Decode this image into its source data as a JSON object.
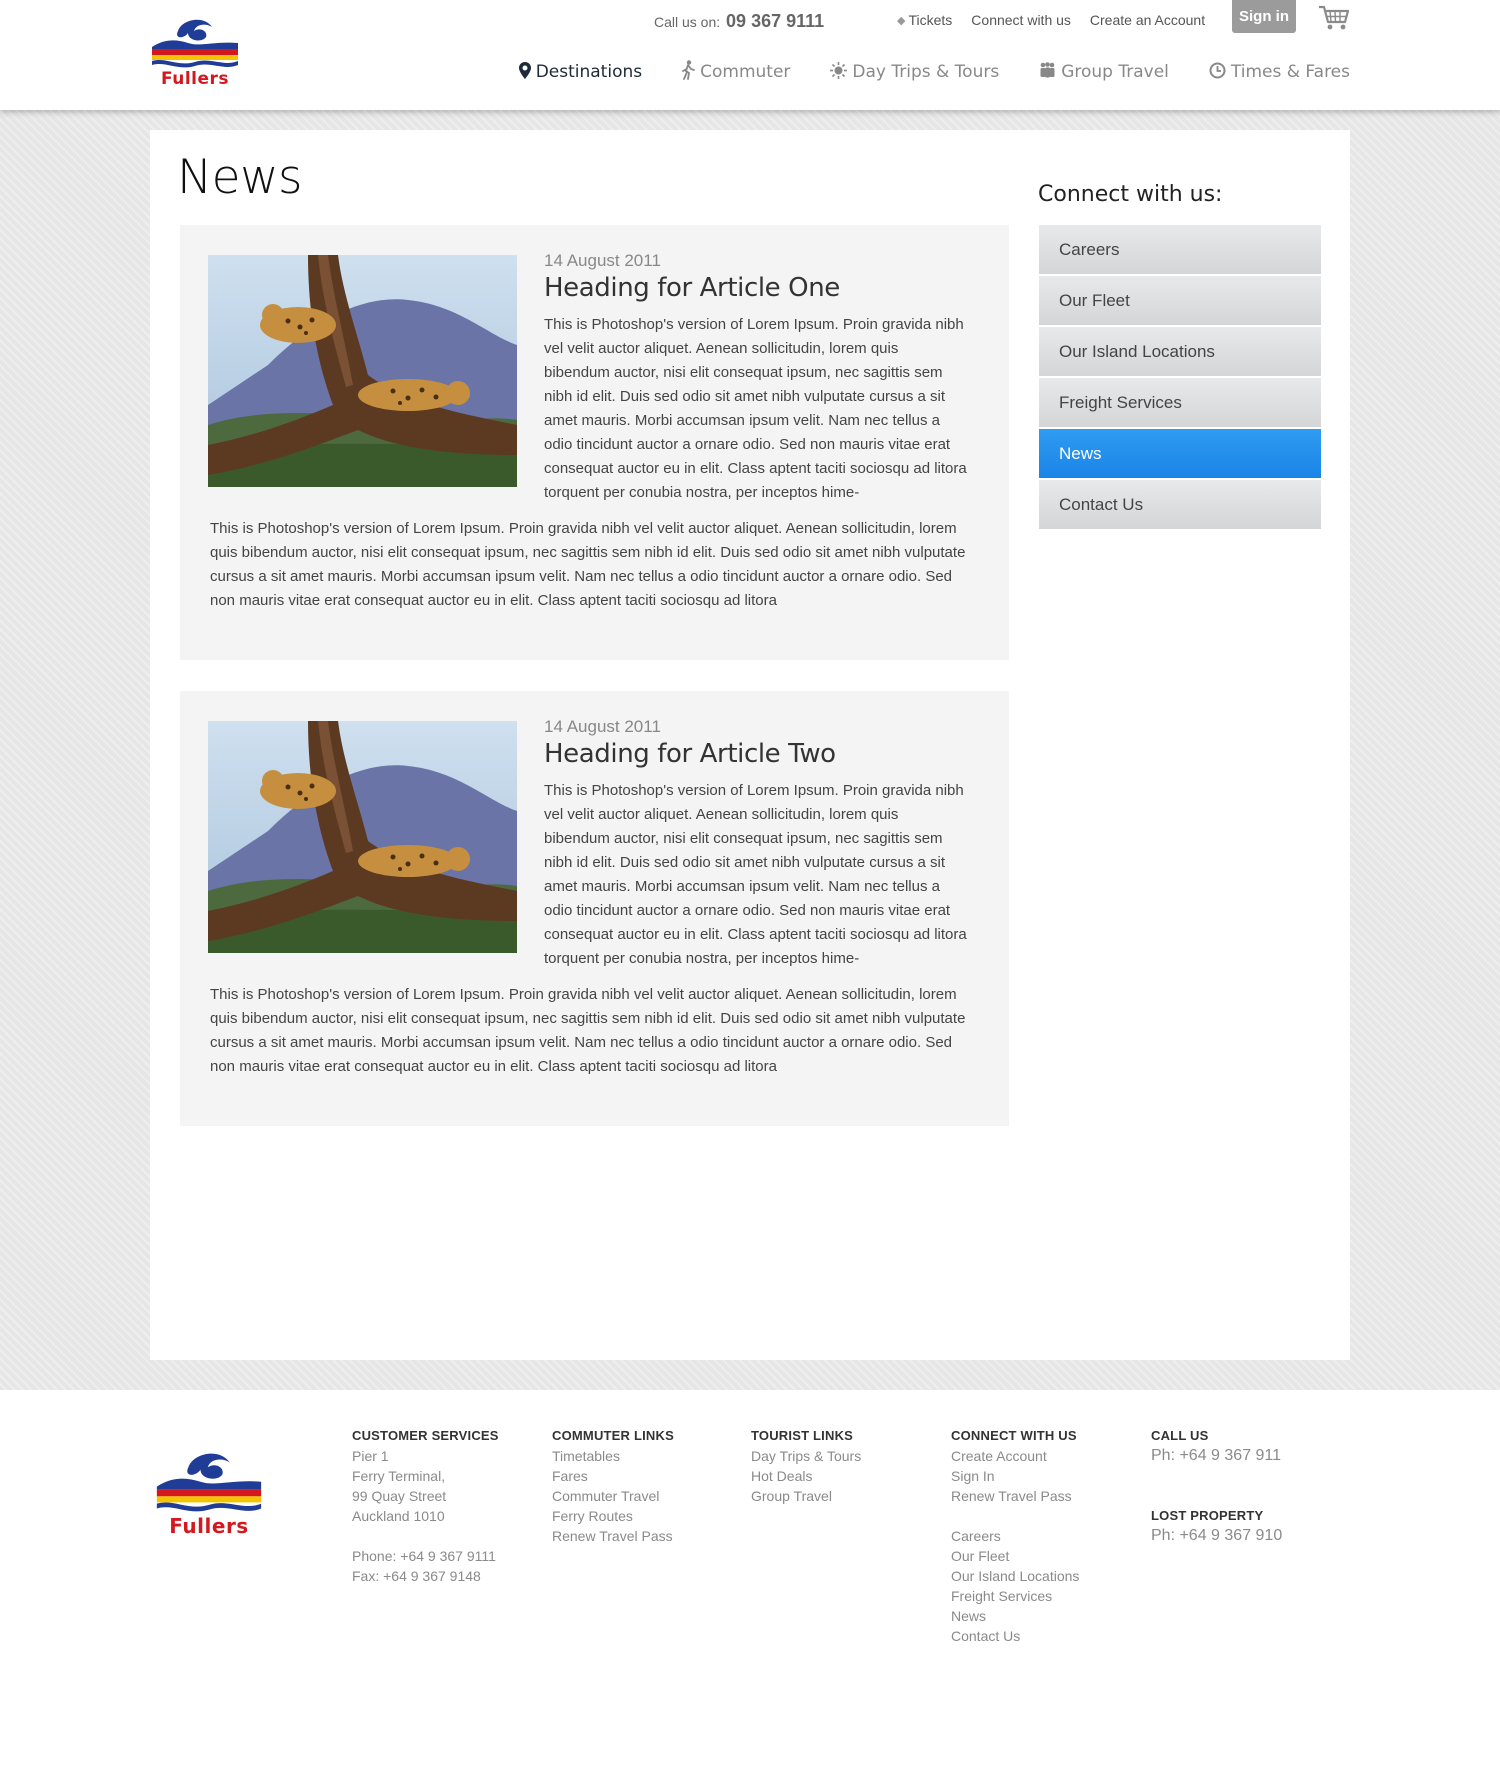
{
  "brand": {
    "name": "Fullers"
  },
  "header": {
    "callus_label": "Call us on:",
    "callus_number": "09 367 9111",
    "top_links": [
      {
        "label": "Tickets",
        "icon": "tag-icon"
      },
      {
        "label": "Connect with us"
      },
      {
        "label": "Create an Account"
      }
    ],
    "signin_label": "Sign in",
    "nav": [
      {
        "label": "Destinations",
        "icon": "map-pin-icon",
        "active": true
      },
      {
        "label": "Commuter",
        "icon": "walking-person-icon"
      },
      {
        "label": "Day Trips & Tours",
        "icon": "sun-icon"
      },
      {
        "label": "Group Travel",
        "icon": "group-icon"
      },
      {
        "label": "Times & Fares",
        "icon": "clock-icon"
      }
    ]
  },
  "page": {
    "title": "News"
  },
  "articles": [
    {
      "date": "14 August 2011",
      "heading": "Heading for Article One",
      "image": "leopard-in-tree",
      "para1": "This is Photoshop's version  of Lorem Ipsum. Proin gravida nibh vel velit auctor aliquet. Aenean sollicitudin, lorem quis bibendum auctor, nisi elit consequat ipsum, nec sagittis sem nibh id elit. Duis sed odio sit amet nibh vulputate cursus a sit amet mauris. Morbi accumsan ipsum velit. Nam nec tellus a odio tincidunt auctor a ornare odio. Sed non  mauris vitae erat consequat auctor eu in elit. Class aptent taciti sociosqu ad litora torquent per conubia nostra, per inceptos hime-",
      "para2": "This is Photoshop's version  of Lorem Ipsum. Proin gravida nibh vel velit auctor aliquet. Aenean sollicitudin, lorem quis bibendum auctor, nisi elit consequat ipsum, nec sagittis sem nibh id elit. Duis sed odio sit amet nibh vulputate cursus a sit amet mauris. Morbi accumsan ipsum velit. Nam nec tellus a odio tincidunt auctor a ornare odio. Sed non  mauris vitae erat consequat auctor eu in elit. Class aptent taciti sociosqu ad litora"
    },
    {
      "date": "14 August 2011",
      "heading": "Heading for Article Two",
      "image": "leopard-in-tree",
      "para1": "This is Photoshop's version  of Lorem Ipsum. Proin gravida nibh vel velit auctor aliquet. Aenean sollicitudin, lorem quis bibendum auctor, nisi elit consequat ipsum, nec sagittis sem nibh id elit. Duis sed odio sit amet nibh vulputate cursus a sit amet mauris. Morbi accumsan ipsum velit. Nam nec tellus a odio tincidunt auctor a ornare odio. Sed non  mauris vitae erat consequat auctor eu in elit. Class aptent taciti sociosqu ad litora torquent per conubia nostra, per inceptos hime-",
      "para2": "This is Photoshop's version  of Lorem Ipsum. Proin gravida nibh vel velit auctor aliquet. Aenean sollicitudin, lorem quis bibendum auctor, nisi elit consequat ipsum, nec sagittis sem nibh id elit. Duis sed odio sit amet nibh vulputate cursus a sit amet mauris. Morbi accumsan ipsum velit. Nam nec tellus a odio tincidunt auctor a ornare odio. Sed non  mauris vitae erat consequat auctor eu in elit. Class aptent taciti sociosqu ad litora"
    }
  ],
  "sidebar": {
    "title": "Connect with us:",
    "items": [
      {
        "label": "Careers"
      },
      {
        "label": "Our Fleet"
      },
      {
        "label": "Our Island Locations"
      },
      {
        "label": "Freight Services"
      },
      {
        "label": "News",
        "active": true
      },
      {
        "label": "Contact Us"
      }
    ]
  },
  "footer": {
    "customer_services": {
      "heading": "CUSTOMER SERVICES",
      "address": [
        "Pier 1",
        "Ferry Terminal,",
        "99 Quay Street",
        "Auckland 1010"
      ],
      "phone": "Phone: +64 9 367 9111",
      "fax": "Fax: +64 9 367 9148"
    },
    "commuter_links": {
      "heading": "COMMUTER LINKS",
      "items": [
        "Timetables",
        "Fares",
        "Commuter Travel",
        "Ferry Routes",
        "Renew Travel Pass"
      ]
    },
    "tourist_links": {
      "heading": "TOURIST LINKS",
      "items": [
        "Day Trips & Tours",
        "Hot Deals",
        "Group Travel"
      ]
    },
    "connect": {
      "heading": "CONNECT WITH US",
      "items_a": [
        "Create Account",
        "Sign In",
        "Renew Travel Pass"
      ],
      "items_b": [
        "Careers",
        "Our Fleet",
        "Our Island Locations",
        "Freight Services",
        "News",
        "Contact Us"
      ]
    },
    "call_us": {
      "heading": "CALL US",
      "phone": "Ph: +64 9 367 911"
    },
    "lost_property": {
      "heading": "LOST PROPERTY",
      "phone": "Ph: +64 9 367 910"
    }
  },
  "colors": {
    "accent": "#1a85e8",
    "brand_red": "#d4181f",
    "brand_blue": "#1f3c96"
  }
}
